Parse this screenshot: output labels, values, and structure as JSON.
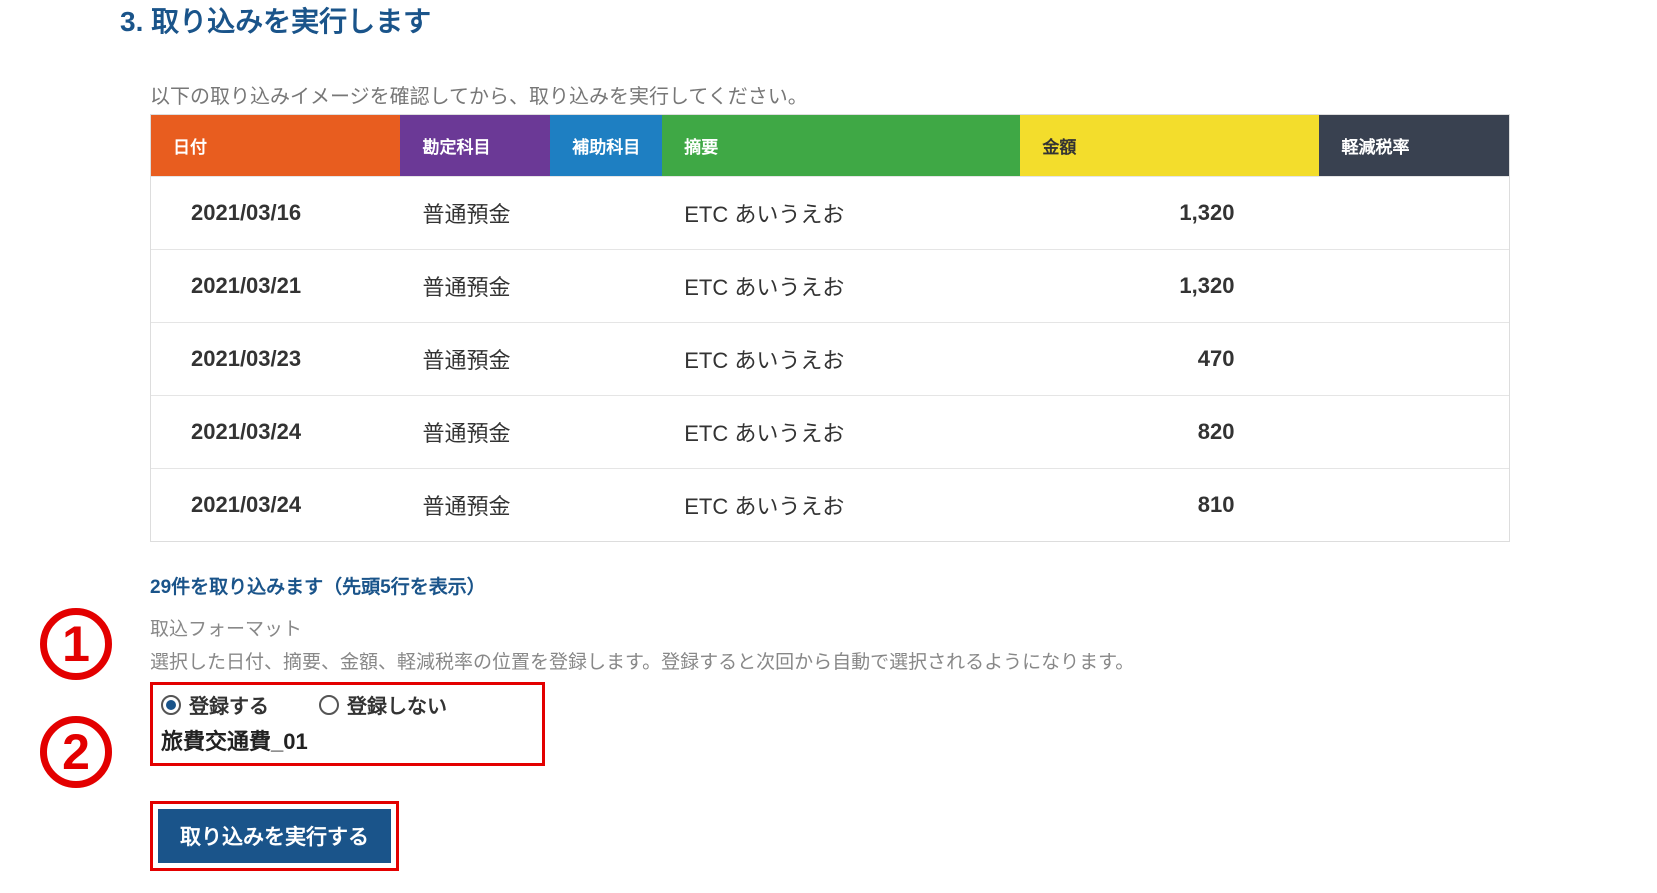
{
  "section_title": "3. 取り込みを実行します",
  "instruction": "以下の取り込みイメージを確認してから、取り込みを実行してください。",
  "table": {
    "headers": {
      "date": "日付",
      "account": "勘定科目",
      "subaccount": "補助科目",
      "summary": "摘要",
      "amount": "金額",
      "taxrate": "軽減税率"
    },
    "rows": [
      {
        "date": "2021/03/16",
        "account": "普通預金",
        "subaccount": "",
        "summary": "ETC あいうえお",
        "amount": "1,320",
        "taxrate": ""
      },
      {
        "date": "2021/03/21",
        "account": "普通預金",
        "subaccount": "",
        "summary": "ETC あいうえお",
        "amount": "1,320",
        "taxrate": ""
      },
      {
        "date": "2021/03/23",
        "account": "普通預金",
        "subaccount": "",
        "summary": "ETC あいうえお",
        "amount": "470",
        "taxrate": ""
      },
      {
        "date": "2021/03/24",
        "account": "普通預金",
        "subaccount": "",
        "summary": "ETC あいうえお",
        "amount": "820",
        "taxrate": ""
      },
      {
        "date": "2021/03/24",
        "account": "普通預金",
        "subaccount": "",
        "summary": "ETC あいうえお",
        "amount": "810",
        "taxrate": ""
      }
    ]
  },
  "import_count": "29件を取り込みます（先頭5行を表示）",
  "format_label": "取込フォーマット",
  "format_desc": "選択した日付、摘要、金額、軽減税率の位置を登録します。登録すると次回から自動で選択されるようになります。",
  "radios": {
    "register": "登録する",
    "no_register": "登録しない"
  },
  "format_input_value": "旅費交通費_01",
  "execute_button": "取り込みを実行する",
  "annotations": {
    "one": "1",
    "two": "2"
  }
}
